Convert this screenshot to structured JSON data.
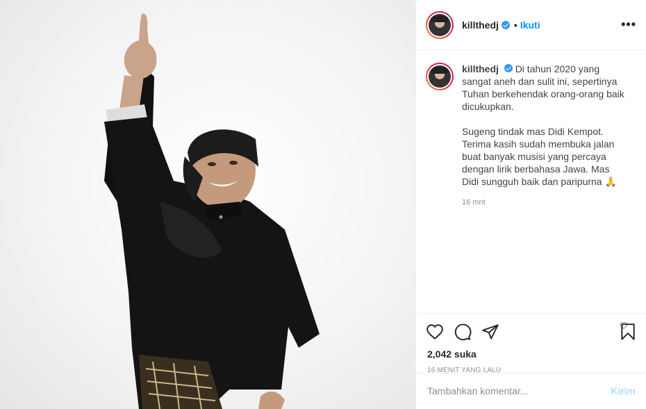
{
  "photo": {
    "alt": "Man in black outfit pointing upward"
  },
  "header": {
    "username": "killthedj",
    "dot": "•",
    "follow_label": "Ikuti",
    "more_label": "•••"
  },
  "caption": {
    "username": "killthedj",
    "paragraph1": "Di tahun 2020 yang sangat aneh dan sulit ini, sepertinya Tuhan berkehendak orang-orang baik dicukupkan.",
    "paragraph2": "Sugeng tindak mas Didi Kempot. Terima kasih sudah membuka jalan buat banyak musisi yang percaya dengan lirik berbahasa Jawa. Mas Didi sungguh baik dan paripurna 🙏",
    "time": "16 mnt"
  },
  "actions": {
    "likes": "2,042 suka",
    "time_ago": "16 MENIT YANG LALU"
  },
  "comment_box": {
    "placeholder": "Tambahkan komentar...",
    "post_label": "Kirim"
  },
  "colors": {
    "accent": "#0095f6",
    "post_disabled": "#b2dffc",
    "verified": "#3897f0"
  }
}
